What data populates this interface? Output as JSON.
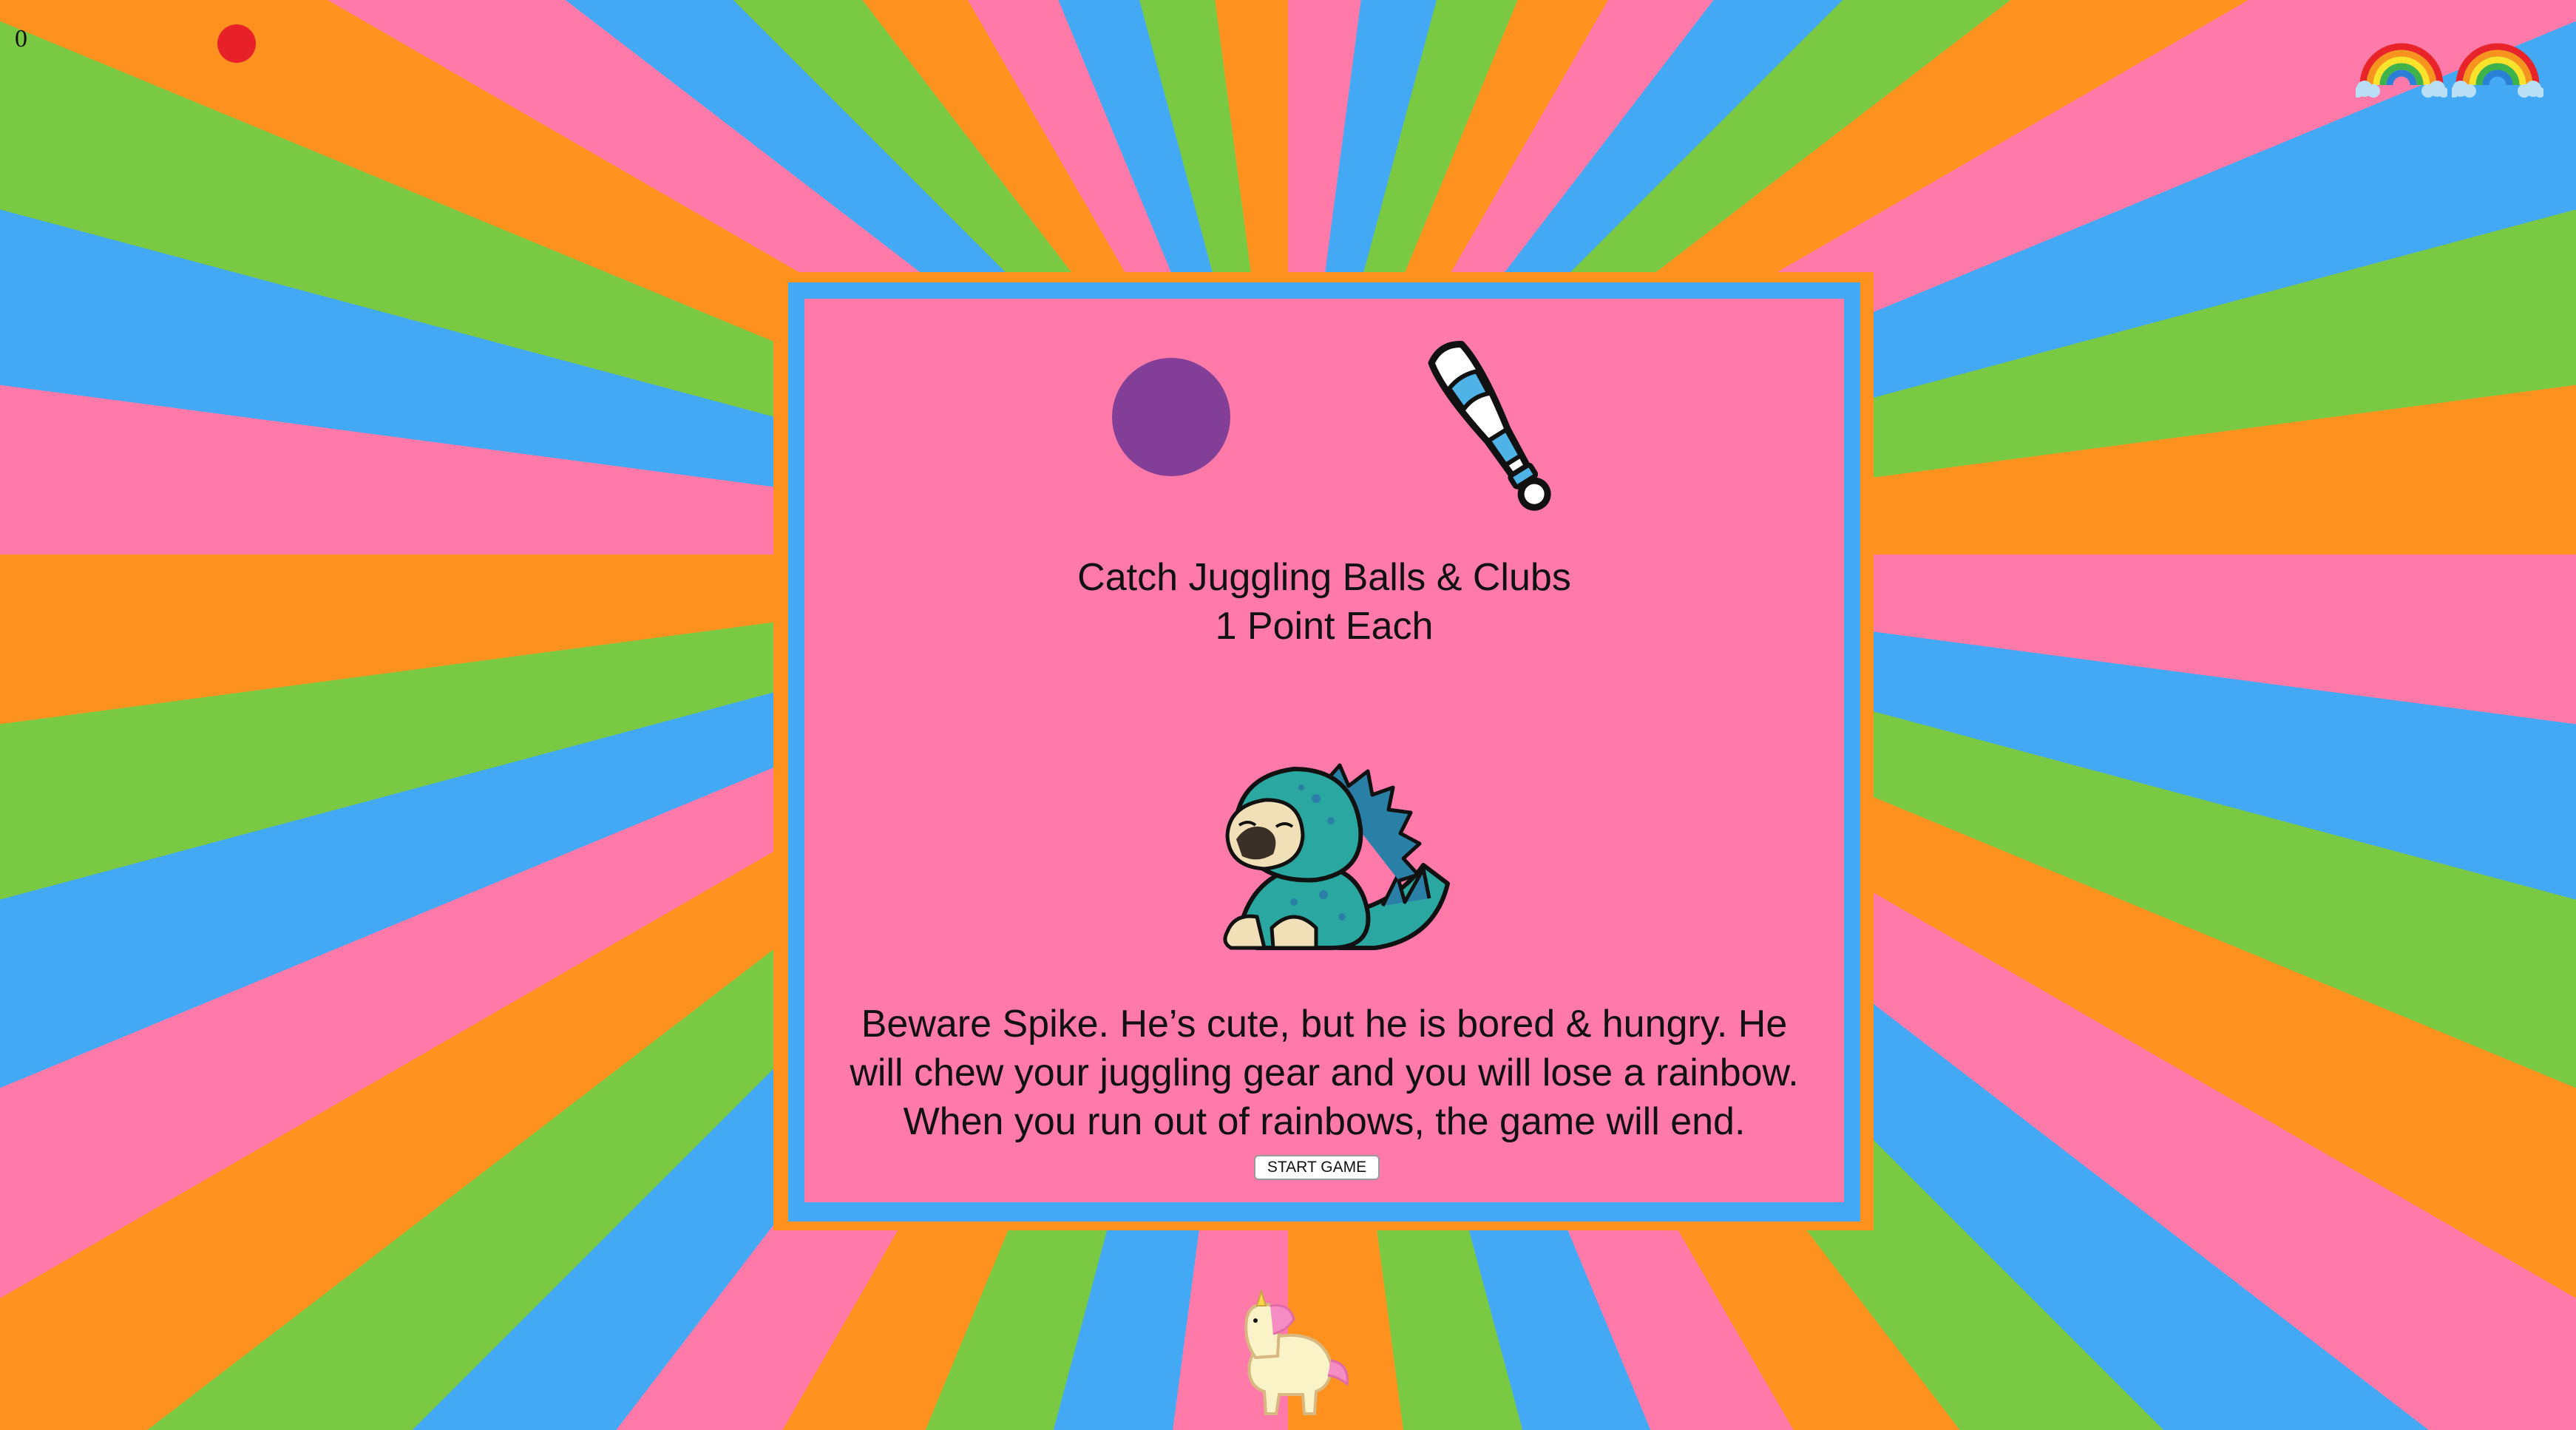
{
  "game": {
    "score": "0",
    "lives_remaining": 2,
    "life_icon": "rainbow-icon",
    "player_icon": "unicorn-icon",
    "enemy_icon": "pug-dinosaur-icon"
  },
  "instructions": {
    "headline_line1": "Catch Juggling Balls & Clubs",
    "headline_line2": "1 Point Each",
    "warning_line1": "Beware Spike.  He’s cute, but he is bored & hungry.  He",
    "warning_line2": "will chew your juggling gear and you will lose a rainbow.",
    "warning_line3": "When you run out of rainbows, the game will end.",
    "start_label": "START GAME"
  },
  "colors": {
    "stripe_pink": "#ff7aa8",
    "stripe_blue": "#44a9f4",
    "stripe_green": "#7ac943",
    "stripe_orange": "#ff921e",
    "panel_pink": "#ff7aa8",
    "panel_border_blue": "#44a9f4",
    "panel_border_orange": "#ff921e",
    "ball_purple": "#833f98",
    "indicator_red": "#e82027",
    "club_blue": "#4fb3e8"
  }
}
